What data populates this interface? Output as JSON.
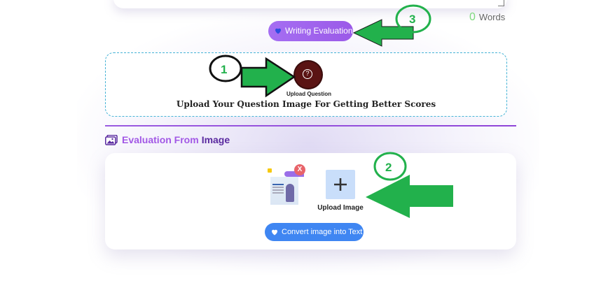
{
  "editor": {
    "word_count": "0",
    "word_count_label": "Words"
  },
  "evaluation_button": {
    "label": "Writing Evaluation"
  },
  "question_upload": {
    "icon_label": "Upload Question",
    "title": "Upload Your Question Image For Getting Better Scores"
  },
  "image_section": {
    "title_part1": "Evaluation From",
    "title_part2": "Image",
    "remove_label": "X",
    "upload_label": "Upload Image",
    "convert_button": "Convert image into Text"
  },
  "annotations": {
    "marker_1": "1",
    "marker_2": "2",
    "marker_3": "3"
  },
  "colors": {
    "evaluation_button": "#9b5ae8",
    "convert_button": "#3f86f2",
    "arrow_green": "#22b14c",
    "question_icon_bg": "#5a1313"
  }
}
